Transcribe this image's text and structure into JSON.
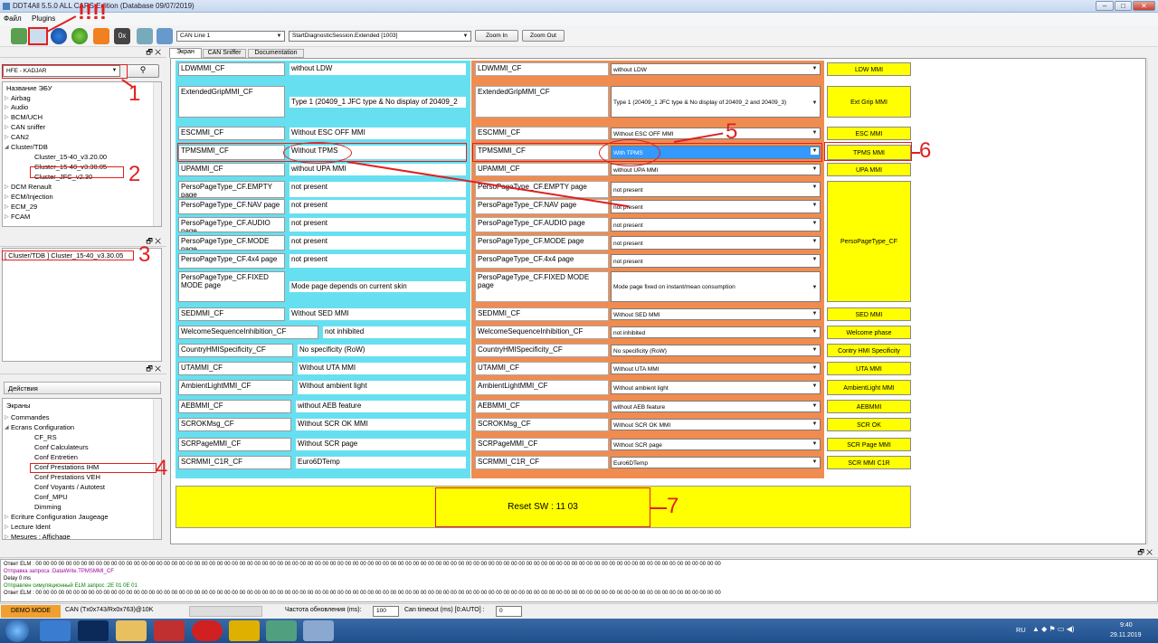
{
  "window": {
    "title": "DDT4All 5.5.0 ALL CARS Edition (Database 09/07/2019)",
    "min": "–",
    "max": "□",
    "close": "✕"
  },
  "menu": [
    "Файл",
    "Plugins"
  ],
  "toolbar": {
    "exclaim": "!!!!",
    "can_line": "CAN Line 1",
    "session": "StartDiagnosticSession.Extended [1003]",
    "zoom_in": "Zoom In",
    "zoom_out": "Zoom Out"
  },
  "panel_close": "🗗 ✕",
  "left": {
    "vehicle": "HFE - KADJAR",
    "ecu_header": "Название ЭБУ",
    "ecu_tree": [
      {
        "label": "Airbag",
        "arrow": "▷"
      },
      {
        "label": "Audio",
        "arrow": "▷"
      },
      {
        "label": "BCM/UCH",
        "arrow": "▷"
      },
      {
        "label": "CAN sniffer",
        "arrow": "▷"
      },
      {
        "label": "CAN2",
        "arrow": "▷"
      },
      {
        "label": "Cluster/TDB",
        "arrow": "◢"
      },
      {
        "label": "Cluster_15-40_v3.20.00",
        "arrow": ""
      },
      {
        "label": "Cluster_15-40_v3.30.05",
        "arrow": ""
      },
      {
        "label": "Cluster_JFC_v2.30",
        "arrow": ""
      },
      {
        "label": "DCM Renault",
        "arrow": "▷"
      },
      {
        "label": "ECM/Injection",
        "arrow": "▷"
      },
      {
        "label": "ECM_29",
        "arrow": "▷"
      },
      {
        "label": "FCAM",
        "arrow": "▷"
      }
    ],
    "selected_ecu": "[ Cluster/TDB ] Cluster_15-40_v3.30.05",
    "actions_label": "Действия",
    "screens_header": "Экраны",
    "screens_tree": [
      {
        "label": "Commandes",
        "arrow": "▷"
      },
      {
        "label": "Ecrans Configuration",
        "arrow": "◢"
      },
      {
        "label": "CF_RS",
        "arrow": ""
      },
      {
        "label": "Conf Calculateurs",
        "arrow": ""
      },
      {
        "label": "Conf Entretien",
        "arrow": ""
      },
      {
        "label": "Conf Prestations IHM",
        "arrow": ""
      },
      {
        "label": "Conf Prestations VEH",
        "arrow": ""
      },
      {
        "label": "Conf Voyants / Autotest",
        "arrow": ""
      },
      {
        "label": "Conf_MPU",
        "arrow": ""
      },
      {
        "label": "Dimming",
        "arrow": ""
      },
      {
        "label": "Ecriture Configuration Jaugeage",
        "arrow": "▷"
      },
      {
        "label": "Lecture Ident",
        "arrow": "▷"
      },
      {
        "label": "Mesures : Affichage",
        "arrow": "▷"
      }
    ]
  },
  "tabs": [
    "Экран",
    "CAN Sniffer",
    "Documentation"
  ],
  "rows": [
    {
      "name": "LDWMMI_CF",
      "current": "without LDW",
      "wname": "LDWMMI_CF",
      "wval": "without LDW",
      "btn": "LDW MMI"
    },
    {
      "name": "ExtendedGripMMI_CF",
      "current": "Type 1  (20409_1 JFC type & No display of 20409_2",
      "wname": "ExtendedGripMMI_CF",
      "wval": "Type 1  (20409_1 JFC type & No display of 20409_2 and 20409_3)",
      "btn": "Ext Grip MMI"
    },
    {
      "name": "ESCMMI_CF",
      "current": "Without ESC OFF MMI",
      "wname": "ESCMMI_CF",
      "wval": "Without ESC OFF MMI",
      "btn": "ESC MMI"
    },
    {
      "name": "TPMSMMI_CF",
      "current": "Without TPMS",
      "wname": "TPMSMMI_CF",
      "wval": "With TPMS",
      "btn": "TPMS MMI"
    },
    {
      "name": "UPAMMI_CF",
      "current": "without UPA MMI",
      "wname": "UPAMMI_CF",
      "wval": "without UPA MMI",
      "btn": "UPA MMI"
    },
    {
      "name": "PersoPageType_CF.EMPTY page",
      "current": "not present",
      "wname": "PersoPageType_CF.EMPTY page",
      "wval": "not present",
      "btn": "PersoPageType_CF"
    },
    {
      "name": "PersoPageType_CF.NAV page",
      "current": "not present",
      "wname": "PersoPageType_CF.NAV page",
      "wval": "not present",
      "btn": ""
    },
    {
      "name": "PersoPageType_CF.AUDIO page",
      "current": "not present",
      "wname": "PersoPageType_CF.AUDIO page",
      "wval": "not present",
      "btn": ""
    },
    {
      "name": "PersoPageType_CF.MODE page",
      "current": "not present",
      "wname": "PersoPageType_CF.MODE page",
      "wval": "not present",
      "btn": ""
    },
    {
      "name": "PersoPageType_CF.4x4 page",
      "current": "not present",
      "wname": "PersoPageType_CF.4x4 page",
      "wval": "not present",
      "btn": ""
    },
    {
      "name": "PersoPageType_CF.FIXED MODE page",
      "current": "Mode page depends on current skin",
      "wname": "PersoPageType_CF.FIXED MODE page",
      "wval": "Mode page fixed on instant/mean consumption",
      "btn": ""
    },
    {
      "name": "SEDMMI_CF",
      "current": "Without SED MMI",
      "wname": "SEDMMI_CF",
      "wval": "Without SED MMI",
      "btn": "SED MMI"
    },
    {
      "name": "WelcomeSequenceInhibition_CF",
      "current": "not inhibited",
      "wname": "WelcomeSequenceInhibition_CF",
      "wval": "not inhibited",
      "btn": "Welcome phase"
    },
    {
      "name": "CountryHMISpecificity_CF",
      "current": "No specificity (RoW)",
      "wname": "CountryHMISpecificity_CF",
      "wval": "No specificity (RoW)",
      "btn": "Contry HMI Specificity"
    },
    {
      "name": "UTAMMI_CF",
      "current": "Without UTA MMI",
      "wname": "UTAMMI_CF",
      "wval": "Without UTA MMI",
      "btn": "UTA MMI"
    },
    {
      "name": "AmbientLightMMI_CF",
      "current": "Without ambient light",
      "wname": "AmbientLightMMI_CF",
      "wval": "Without ambient light",
      "btn": "AmbientLight MMI"
    },
    {
      "name": "AEBMMI_CF",
      "current": "without AEB feature",
      "wname": "AEBMMI_CF",
      "wval": "without AEB feature",
      "btn": "AEBMMI"
    },
    {
      "name": "SCROKMsg_CF",
      "current": "Without SCR OK MMI",
      "wname": "SCROKMsg_CF",
      "wval": "Without SCR OK MMI",
      "btn": "SCR OK"
    },
    {
      "name": "SCRPageMMI_CF",
      "current": "Without SCR page",
      "wname": "SCRPageMMI_CF",
      "wval": "Without SCR page",
      "btn": "SCR Page MMI"
    },
    {
      "name": "SCRMMI_C1R_CF",
      "current": "Euro6DTemp",
      "wname": "SCRMMI_C1R_CF",
      "wval": "Euro6DTemp",
      "btn": "SCR MMI C1R"
    }
  ],
  "reset_button": "Reset SW : 11 03",
  "annotations": [
    "1",
    "2",
    "3",
    "4",
    "5",
    "6",
    "7"
  ],
  "log": [
    {
      "text": "Ответ ELM : 00 00 00 00 00 00 00 00 00 00 00 00 00 00 00 00 00 00 00 00 00 00 00 00 00 00 00 00 00 00 00 00 00 00 00 00 00 00 00 00 00 00 00 00 00 00 00 00 00 00 00 00 00 00 00 00 00 00 00 00 00 00 00 00 00 00 00 00 00 00 00 00 00 00 00 00 00 00 00 00 00 00 00 00 00 00 00 00 00 00 00",
      "color": "#000000"
    },
    {
      "text": "Отправка запроса :DataWrite.TPMSMMI_CF",
      "color": "#a000a0"
    },
    {
      "text": "Delay 0 ms",
      "color": "#000000"
    },
    {
      "text": "Отправлен симуляционный ELM запрос :2E 01 0E 01",
      "color": "#008000"
    },
    {
      "text": "Ответ ELM : 00 00 00 00 00 00 00 00 00 00 00 00 00 00 00 00 00 00 00 00 00 00 00 00 00 00 00 00 00 00 00 00 00 00 00 00 00 00 00 00 00 00 00 00 00 00 00 00 00 00 00 00 00 00 00 00 00 00 00 00 00 00 00 00 00 00 00 00 00 00 00 00 00 00 00 00 00 00 00 00 00 00 00 00 00 00 00 00 00 00 00",
      "color": "#000000"
    }
  ],
  "status": {
    "demo": "DEMO MODE",
    "can": "CAN (Tx0x743/Rx0x763)@10K",
    "refresh_label": "Частота обновления (ms):",
    "refresh": "100",
    "timeout_label": "Can timeout (ms) [0:AUTO] :",
    "timeout": "0"
  },
  "taskbar": {
    "lang": "RU",
    "time": "9:40",
    "date": "29.11.2019"
  },
  "colors": {
    "cyan": "#66e0f0",
    "orange": "#f08c50",
    "yellow": "#ffff00",
    "annotation": "#e02020",
    "demo": "#f0a030"
  }
}
